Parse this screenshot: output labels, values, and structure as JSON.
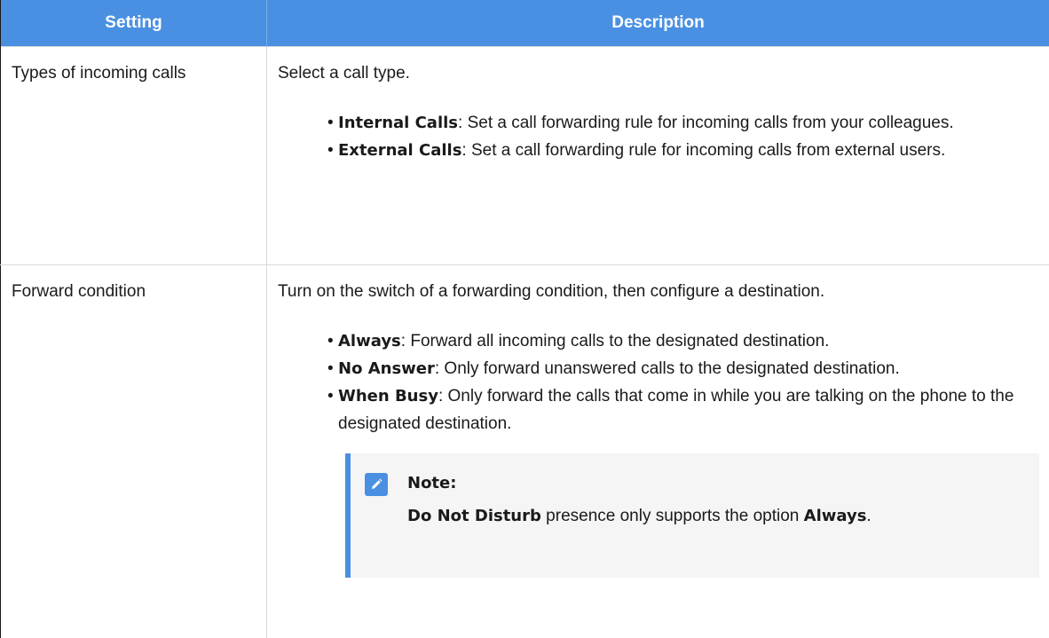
{
  "header": {
    "setting": "Setting",
    "description": "Description"
  },
  "rows": [
    {
      "setting": "Types of incoming calls",
      "intro": "Select a call type.",
      "items": [
        {
          "term": "Internal Calls",
          "text": ": Set a call forwarding rule for incoming calls from your colleagues."
        },
        {
          "term": "External Calls",
          "text": ": Set a call forwarding rule for incoming calls from external users."
        }
      ]
    },
    {
      "setting": "Forward condition",
      "intro": "Turn on the switch of a forwarding condition, then configure a destination.",
      "items": [
        {
          "term": "Always",
          "text": ": Forward all incoming calls to the designated destination."
        },
        {
          "term": "No Answer",
          "text": ": Only forward unanswered calls to the designated destination."
        },
        {
          "term": "When Busy",
          "text": ": Only forward the calls that come in while you are talking on the phone to the designated destination."
        }
      ],
      "note": {
        "title": "Note:",
        "bold1": "Do Not Disturb",
        "middle": " presence only supports the option ",
        "bold2": "Always",
        "end": "."
      }
    }
  ],
  "colors": {
    "header_bg": "#4a90e2",
    "note_accent": "#4a90e2",
    "note_bg": "#f5f5f5"
  },
  "icons": {
    "note": "pencil-edit-icon"
  }
}
